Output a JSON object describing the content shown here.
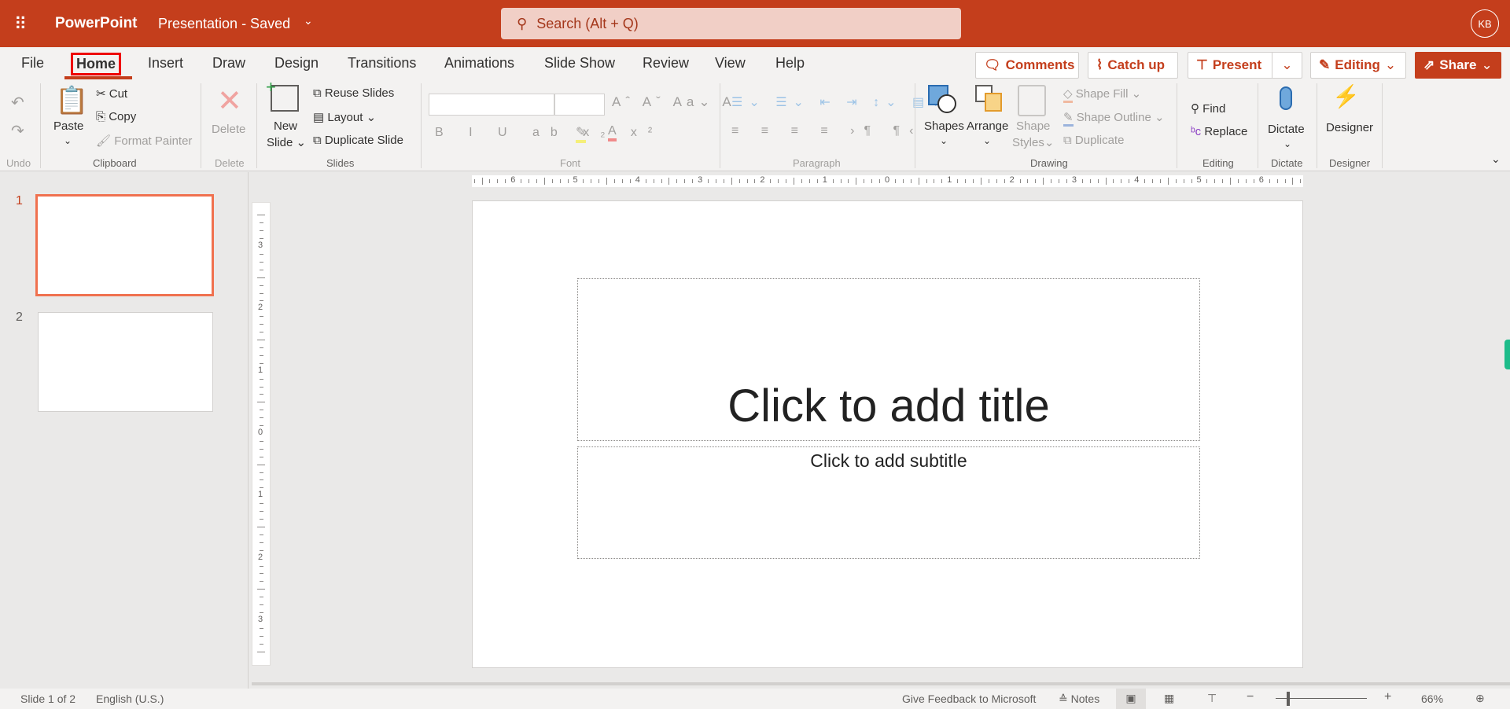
{
  "titlebar": {
    "app": "PowerPoint",
    "doc": "Presentation - Saved",
    "search_placeholder": "Search (Alt + Q)",
    "avatar": "KB"
  },
  "tabs": [
    "File",
    "Home",
    "Insert",
    "Draw",
    "Design",
    "Transitions",
    "Animations",
    "Slide Show",
    "Review",
    "View",
    "Help"
  ],
  "active_tab": "Home",
  "actions": {
    "comments": "Comments",
    "catchup": "Catch up",
    "present": "Present",
    "editing": "Editing",
    "share": "Share"
  },
  "ribbon": {
    "undo": "Undo",
    "clipboard": "Clipboard",
    "paste": "Paste",
    "cut": "Cut",
    "copy": "Copy",
    "format_painter": "Format Painter",
    "delete": "Delete",
    "delete_group": "Delete",
    "new_slide": "New",
    "new_slide2": "Slide",
    "reuse": "Reuse Slides",
    "layout": "Layout",
    "duplicate_slide": "Duplicate Slide",
    "slides": "Slides",
    "font": "Font",
    "paragraph": "Paragraph",
    "shapes": "Shapes",
    "arrange": "Arrange",
    "shape_styles": "Shape",
    "shape_styles2": "Styles",
    "shape_fill": "Shape Fill",
    "shape_outline": "Shape Outline",
    "duplicate": "Duplicate",
    "drawing": "Drawing",
    "find": "Find",
    "replace": "Replace",
    "editing": "Editing",
    "dictate": "Dictate",
    "dictate_group": "Dictate",
    "designer": "Designer",
    "designer_group": "Designer"
  },
  "thumbnails": [
    {
      "num": "1"
    },
    {
      "num": "2"
    }
  ],
  "ruler_h": [
    "6",
    "5",
    "4",
    "3",
    "2",
    "1",
    "0",
    "1",
    "2",
    "3",
    "4",
    "5",
    "6"
  ],
  "ruler_v": [
    "3",
    "2",
    "1",
    "0",
    "1",
    "2",
    "3"
  ],
  "slide": {
    "title_placeholder": "Click to add title",
    "subtitle_placeholder": "Click to add subtitle"
  },
  "status": {
    "slide": "Slide 1 of 2",
    "lang": "English (U.S.)",
    "feedback": "Give Feedback to Microsoft",
    "notes": "Notes",
    "zoom": "66%"
  },
  "colors": {
    "brand": "#c43e1c",
    "accent_green": "#1ebc8a"
  }
}
